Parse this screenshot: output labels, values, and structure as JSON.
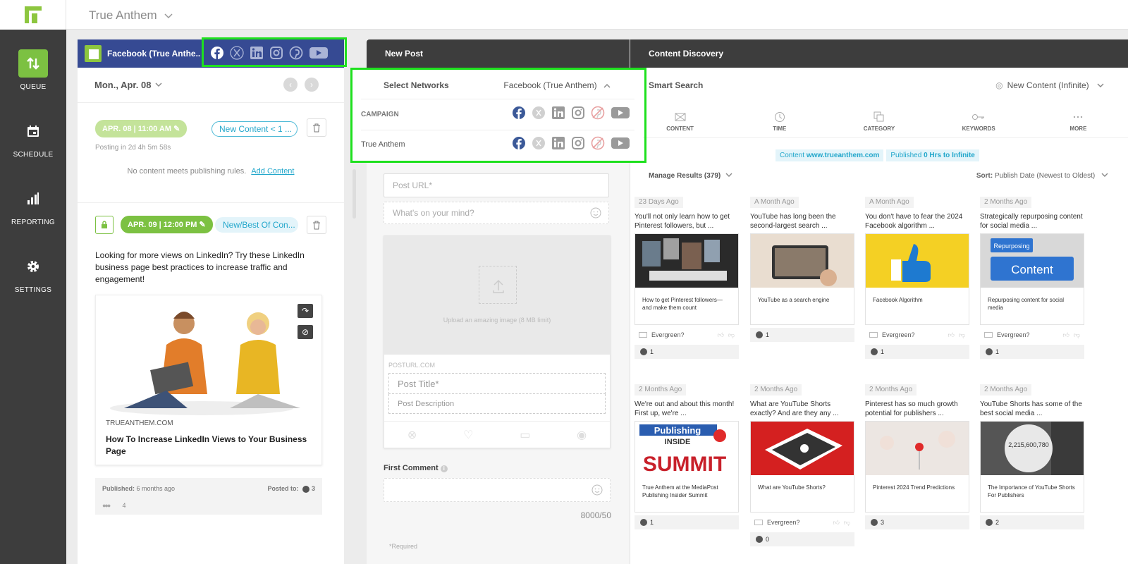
{
  "topbar": {
    "account": "True Anthem"
  },
  "sidebar": {
    "items": [
      {
        "label": "QUEUE",
        "icon": "queue-arrows-icon"
      },
      {
        "label": "SCHEDULE",
        "icon": "calendar-icon"
      },
      {
        "label": "REPORTING",
        "icon": "bar-chart-icon"
      },
      {
        "label": "SETTINGS",
        "icon": "gear-icon"
      }
    ]
  },
  "queue": {
    "header": "Facebook (True Anthe...",
    "date": "Mon., Apr. 08",
    "slot1": {
      "time": "APR. 08 | 11:00 AM",
      "rule": "New Content < 1 ...",
      "countdown": "Posting in 2d 4h 5m 58s",
      "empty": "No content meets publishing rules.",
      "add": "Add Content"
    },
    "slot2": {
      "time": "APR. 09 | 12:00 PM",
      "rule": "New/Best Of Con...",
      "text": "Looking for more views on LinkedIn? Try these LinkedIn business page best practices to increase traffic and engagement!",
      "domain": "TRUEANTHEM.COM",
      "title": "How To Increase LinkedIn Views to Your Business Page",
      "published_label": "Published:",
      "published": "6 months ago",
      "posted_label": "Posted to:",
      "posted_count": "3",
      "reactions": "4"
    }
  },
  "newpost": {
    "header": "New Post",
    "select_label": "Select Networks",
    "selected": "Facebook (True Anthem)",
    "campaign": "CAMPAIGN",
    "account": "True Anthem",
    "url_placeholder": "Post URL*",
    "mind_placeholder": "What's on your mind?",
    "upload": "Upload an amazing image (8 MB limit)",
    "posturl": "POSTURL.COM",
    "title_placeholder": "Post Title*",
    "desc_placeholder": "Post Description",
    "first_comment": "First Comment",
    "counter": "8000/50",
    "required": "*Required"
  },
  "discovery": {
    "header": "Content Discovery",
    "smart": "Smart Search",
    "mode": "New Content (Infinite)",
    "tabs": [
      "CONTENT",
      "TIME",
      "CATEGORY",
      "KEYWORDS",
      "MORE"
    ],
    "filter1_label": "Content",
    "filter1_value": "www.trueanthem.com",
    "filter2_label": "Published",
    "filter2_value": "0 Hrs to Infinite",
    "manage": "Manage Results (379)",
    "sort_label": "Sort:",
    "sort_value": "Publish Date (Newest to Oldest)",
    "evergreen": "Evergreen?",
    "cards": [
      {
        "age": "23 Days Ago",
        "snippet": "You'll not only learn how to get Pinterest followers, but ...",
        "caption": "How to get Pinterest followers—and make them count",
        "count": "1"
      },
      {
        "age": "A Month Ago",
        "snippet": "YouTube has long been the second-largest search ...",
        "caption": "YouTube as a search engine",
        "count": "1"
      },
      {
        "age": "A Month Ago",
        "snippet": "You don't have to fear the 2024 Facebook algorithm ...",
        "caption": "Facebook Algorithm",
        "count": "1"
      },
      {
        "age": "2 Months Ago",
        "snippet": "Strategically repurposing content for social media ...",
        "caption": "Repurposing content for social media",
        "count": "1"
      },
      {
        "age": "2 Months Ago",
        "snippet": "We're out and about this month! First up, we're ...",
        "caption": "True Anthem at the MediaPost Publishing Insider Summit",
        "count": "1"
      },
      {
        "age": "2 Months Ago",
        "snippet": "What are YouTube Shorts exactly? And are they any ...",
        "caption": "What are YouTube Shorts?",
        "count": "0"
      },
      {
        "age": "2 Months Ago",
        "snippet": "Pinterest has so much growth potential for publishers ...",
        "caption": "Pinterest 2024 Trend Predictions",
        "count": "3"
      },
      {
        "age": "2 Months Ago",
        "snippet": "YouTube Shorts has some of the best social media ...",
        "caption": "The Importance of YouTube Shorts For Publishers",
        "count": "2"
      }
    ],
    "img_text": {
      "repurposing": "Repurposing",
      "content": "Content",
      "publishing": "Publishing",
      "inside": "INSIDE",
      "summit": "SUMMIT",
      "views": "2,215,600,780"
    }
  },
  "colors": {
    "accent": "#7cc142",
    "facebook": "#3b5998",
    "link": "#23a7cb",
    "highlight": "#1ee01e"
  }
}
